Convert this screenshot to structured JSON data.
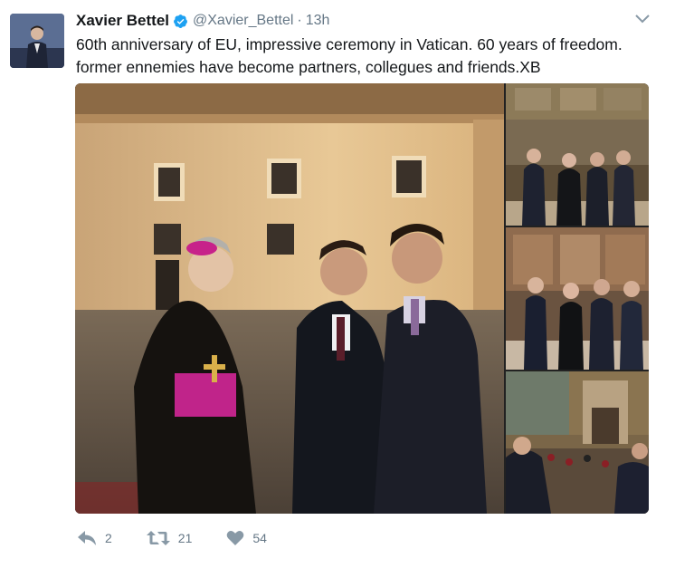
{
  "tweet": {
    "author": {
      "name": "Xavier Bettel",
      "handle": "@Xavier_Bettel",
      "verified": true
    },
    "time": "13h",
    "text_lines": [
      "60th anniversary of EU, impressive ceremony in Vatican. 60 years of freedom.",
      "former ennemies have become partners, collegues and friends.XB"
    ],
    "actions": {
      "reply_count": "2",
      "retweet_count": "21",
      "like_count": "54"
    }
  },
  "icons": {
    "verified": "verified-badge-icon",
    "menu": "chevron-down-icon",
    "reply": "reply-icon",
    "retweet": "retweet-icon",
    "like": "heart-icon"
  },
  "colors": {
    "verified_blue": "#1da1f2",
    "muted": "#657786",
    "text": "#14171a"
  }
}
